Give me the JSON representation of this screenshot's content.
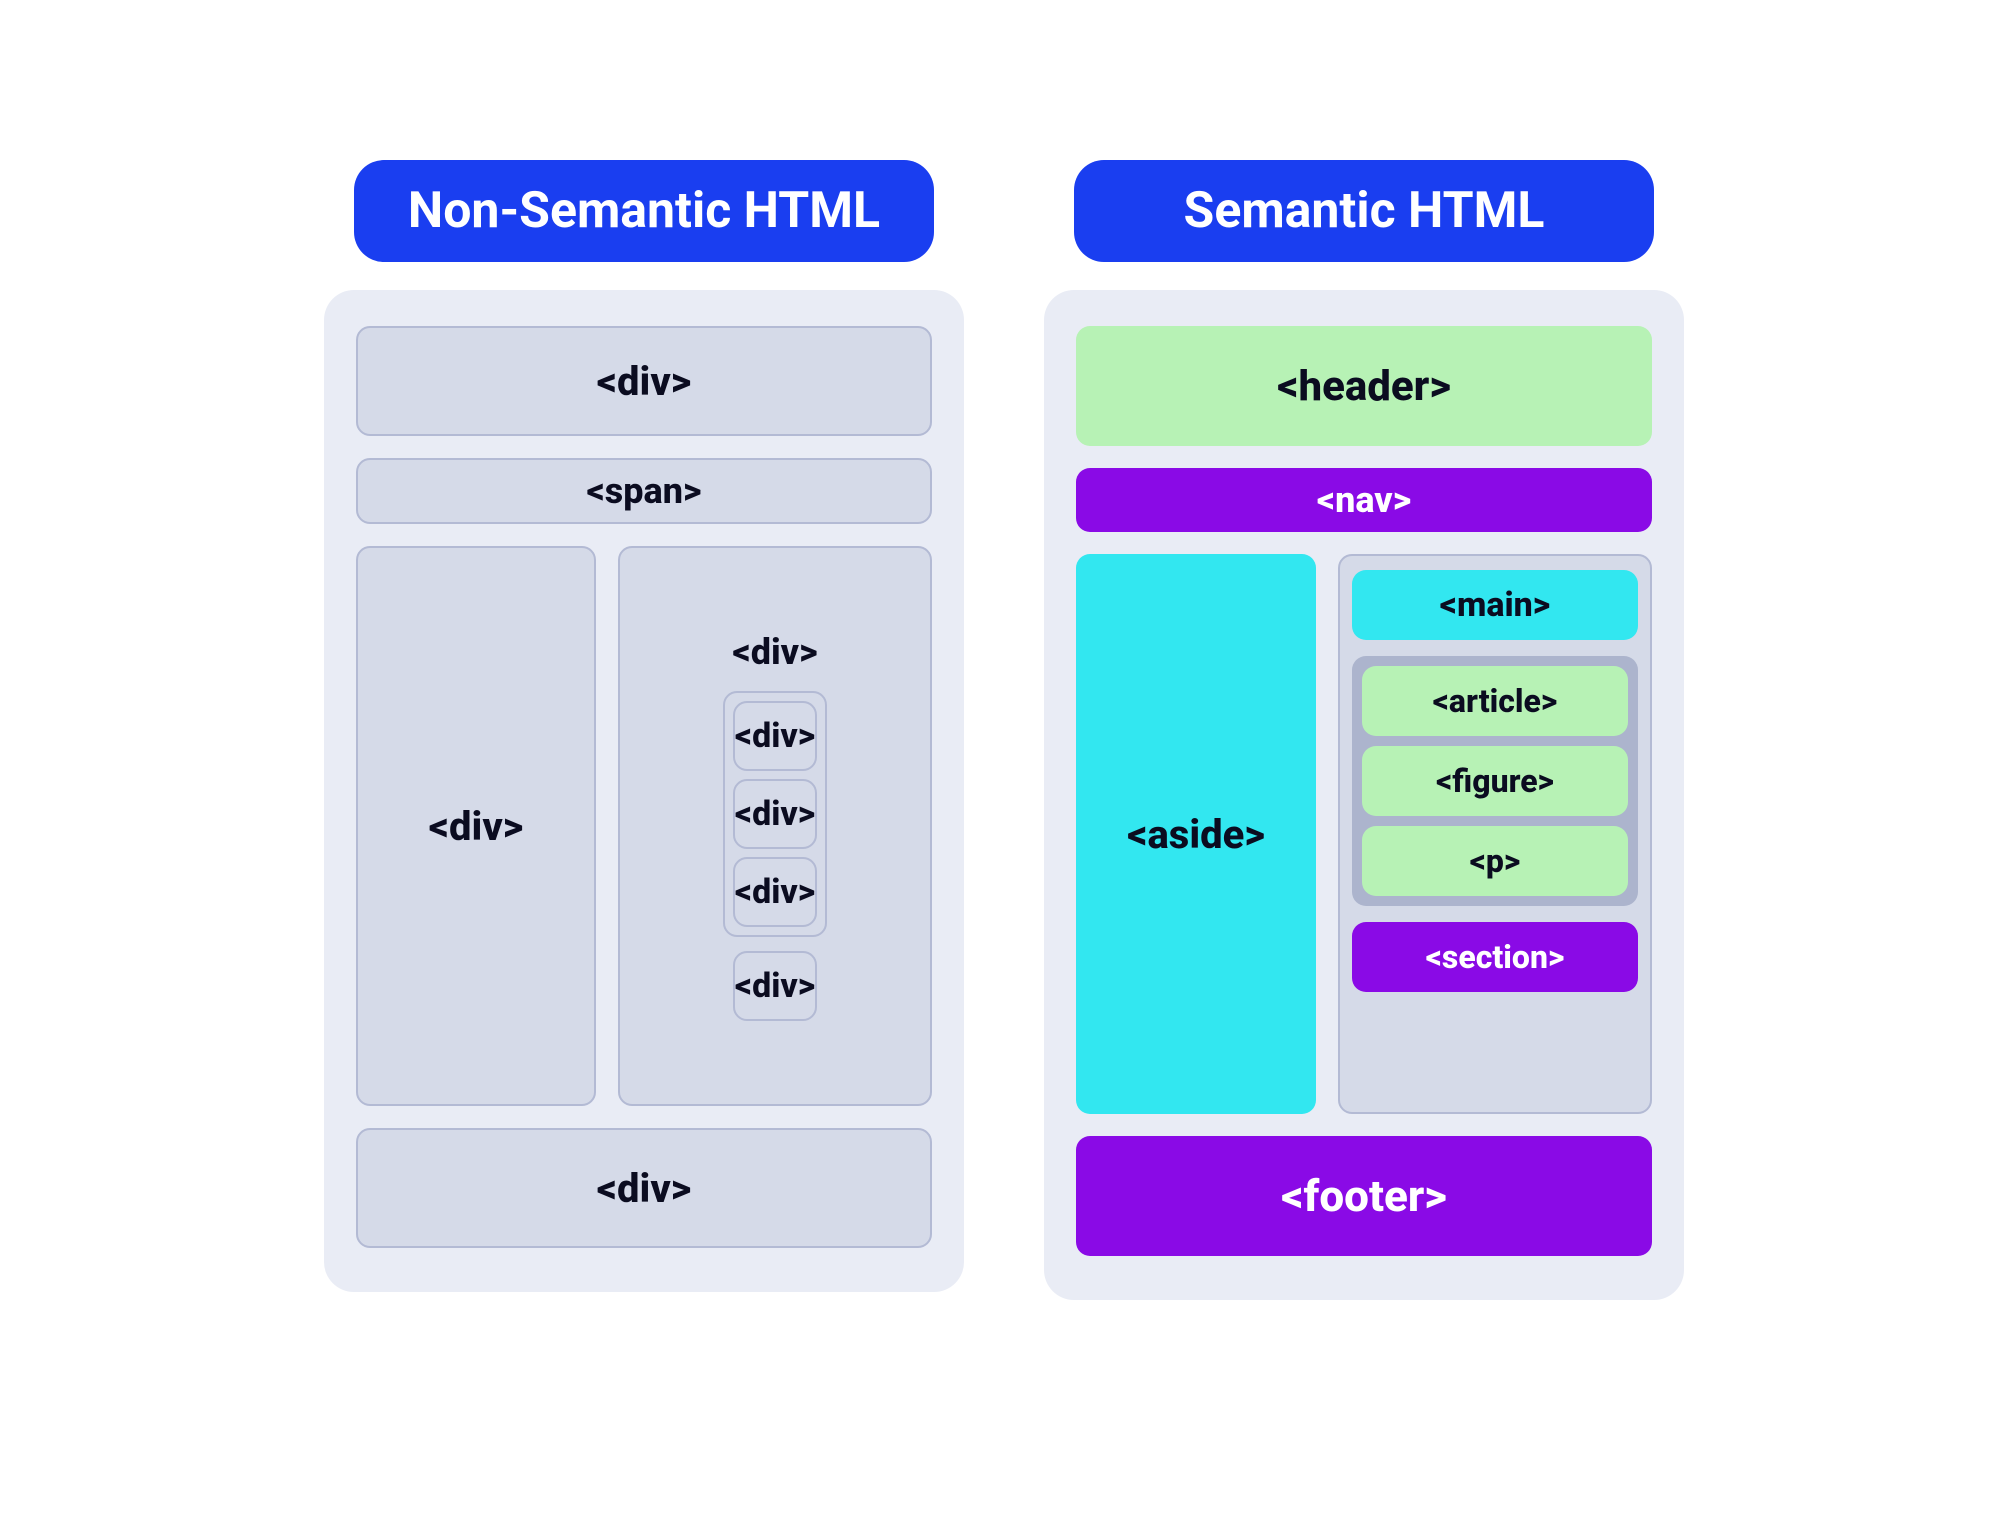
{
  "left": {
    "title": "Non-Semantic HTML",
    "header": "<div>",
    "span": "<span>",
    "aside": "<div>",
    "rightTitle": "<div>",
    "innerGroup": [
      "<div>",
      "<div>",
      "<div>"
    ],
    "afterGroup": "<div>",
    "footer": "<div>"
  },
  "right": {
    "title": "Semantic HTML",
    "header": "<header>",
    "nav": "<nav>",
    "aside": "<aside>",
    "main": "<main>",
    "group": [
      "<article>",
      "<figure>",
      "<p>"
    ],
    "section": "<section>",
    "footer": "<footer>"
  }
}
